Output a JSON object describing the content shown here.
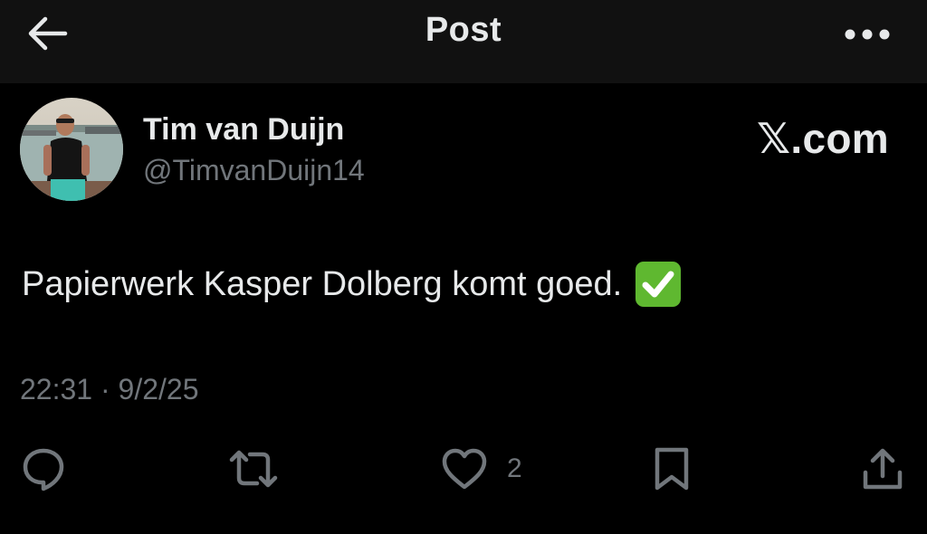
{
  "header": {
    "title": "Post",
    "back_icon": "arrow-left-icon",
    "more_icon": "more-horizontal-icon"
  },
  "tweet": {
    "author_name": "Tim van Duijn",
    "author_handle": "@TimvanDuijn14",
    "brand_x": "𝕏",
    "brand_suffix": ".com",
    "text": "Papierwerk Kasper Dolberg komt goed.",
    "emoji": "white-check-mark-icon",
    "timestamp": "22:31 · 9/2/25"
  },
  "actions": {
    "reply_icon": "reply-icon",
    "repost_icon": "repost-icon",
    "like_icon": "heart-icon",
    "like_count": "2",
    "bookmark_icon": "bookmark-icon",
    "share_icon": "share-icon"
  },
  "colors": {
    "background": "#000000",
    "header_background": "#111111",
    "primary_text": "#e7e9ea",
    "secondary_text": "#71767b",
    "emoji_green": "#5fb830"
  }
}
